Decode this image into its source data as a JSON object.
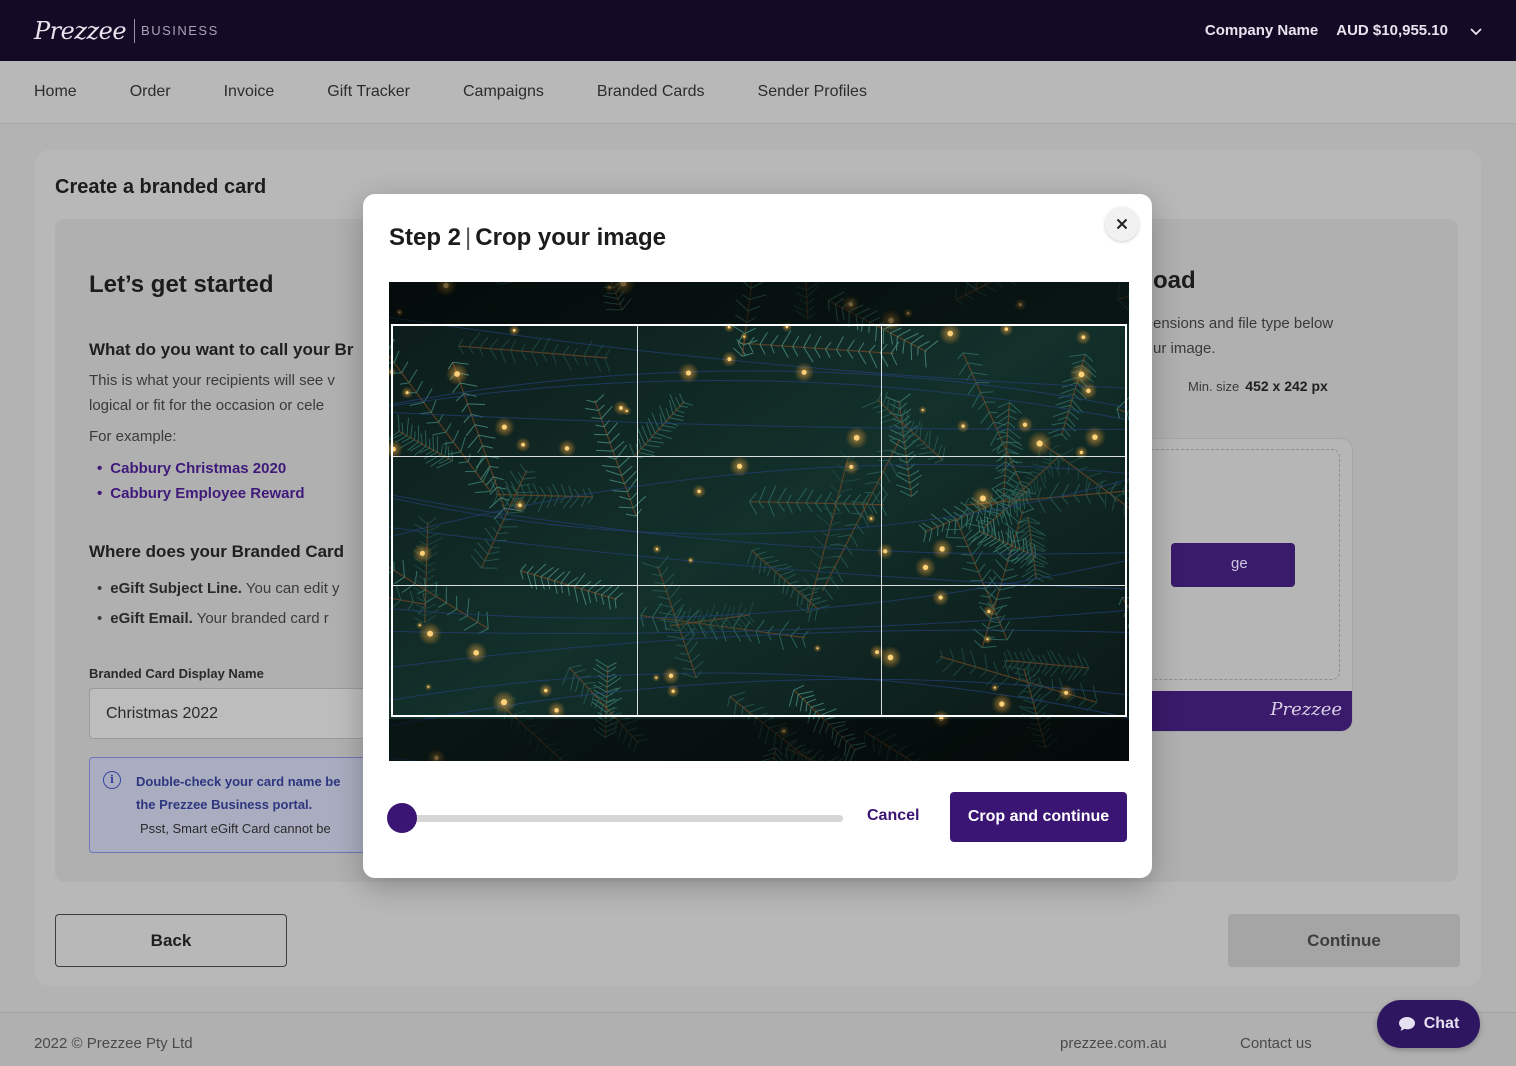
{
  "header": {
    "logo": "Prezzee",
    "logo_suffix": "BUSINESS",
    "company_name": "Company Name",
    "balance": "AUD $10,955.10",
    "menu_icon": "chevron-down-icon"
  },
  "nav": {
    "items": [
      "Home",
      "Order",
      "Invoice",
      "Gift Tracker",
      "Campaigns",
      "Branded Cards",
      "Sender Profiles"
    ]
  },
  "page": {
    "title": "Create a branded card",
    "start_title": "Let’s get started",
    "question_name": "What do you want to call your Br",
    "description_lines": [
      "This is what your recipients will see v",
      "logical or fit for the occasion or cele"
    ],
    "example_label": "For example:",
    "examples": [
      "Cabbury Christmas 2020",
      "Cabbury Employee Reward"
    ],
    "question_where": "Where does your Branded Card",
    "where_items": [
      {
        "bold": "eGift Subject Line.",
        "text": " You can edit y"
      },
      {
        "bold": "eGift Email.",
        "text": " Your branded card r"
      }
    ],
    "field_label": "Branded Card Display Name",
    "field_value": "Christmas 2022",
    "info_lines": [
      "Double-check your card name be",
      "the Prezzee Business portal."
    ],
    "info_sub": "Psst, Smart eGift Card cannot be",
    "upload_title": "oad",
    "upload_desc_lines": [
      "ensions and file type below",
      "ur image."
    ],
    "min_size_label": "Min. size",
    "min_size_value": "452 x 242 px",
    "upload_button": "ge",
    "brand_logo": "Prezzee",
    "back_label": "Back",
    "continue_label": "Continue"
  },
  "modal": {
    "step": "Step 2",
    "separator": "|",
    "title": "Crop your image",
    "close_icon": "close-icon",
    "zoom_level": 0,
    "cancel_label": "Cancel",
    "crop_label": "Crop and continue"
  },
  "footer": {
    "copyright": "2022 © Prezzee Pty Ltd",
    "site_link": "prezzee.com.au",
    "contact_link": "Contact us",
    "chat_label": "Chat",
    "chat_icon": "chat-bubble-icon"
  },
  "colors": {
    "brand_dark": "#150a26",
    "brand_purple": "#3a1573",
    "link_purple": "#3f1a7a"
  }
}
